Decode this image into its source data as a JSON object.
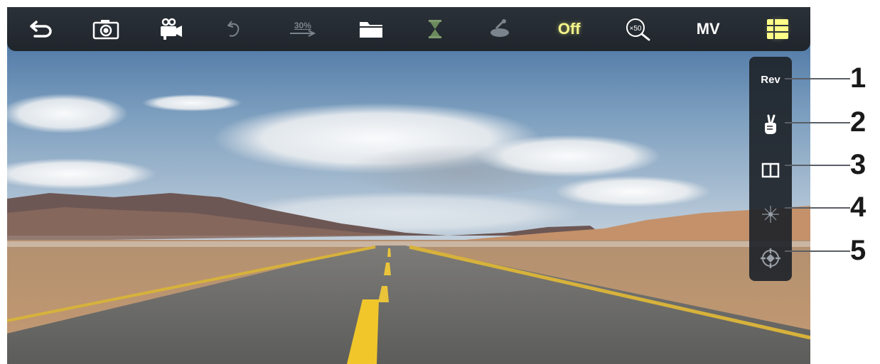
{
  "toolbar": {
    "back_icon": "back-arrow-icon",
    "camera_icon": "camera-icon",
    "video_icon": "video-camera-icon",
    "rotate_icon": "rotate-icon",
    "percent_label": "30%",
    "folder_icon": "folder-icon",
    "timer_icon": "hourglass-icon",
    "satellite_icon": "satellite-icon",
    "off_label": "Off",
    "zoom_label": "×50",
    "mv_label": "MV",
    "menu_icon": "menu-grid-icon"
  },
  "side_panel": {
    "rev_label": "Rev",
    "items": [
      {
        "icon": "rev-text"
      },
      {
        "icon": "gesture-hand-icon"
      },
      {
        "icon": "split-screen-icon"
      },
      {
        "icon": "starburst-icon"
      },
      {
        "icon": "crosshair-target-icon"
      }
    ]
  },
  "callouts": [
    "1",
    "2",
    "3",
    "4",
    "5"
  ],
  "colors": {
    "toolbar_bg": "#252b31",
    "off_text": "#f4f58a",
    "menu_active": "#ffff88",
    "icon_white": "#ffffff",
    "icon_dim": "#7b838c"
  }
}
